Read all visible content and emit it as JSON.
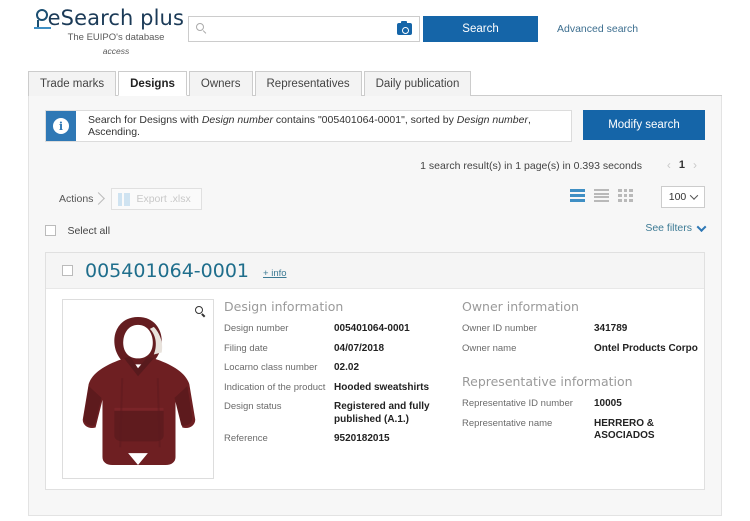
{
  "header": {
    "logo_text": "eSearch plus",
    "tagline": "The EUIPO's database",
    "tagline2": "access",
    "search_value": "",
    "search_placeholder": "",
    "camera_icon": "camera-icon",
    "search_button": "Search",
    "advanced_search": "Advanced search"
  },
  "tabs": [
    {
      "label": "Trade marks",
      "active": false
    },
    {
      "label": "Designs",
      "active": true
    },
    {
      "label": "Owners",
      "active": false
    },
    {
      "label": "Representatives",
      "active": false
    },
    {
      "label": "Daily publication",
      "active": false
    }
  ],
  "info_banner": {
    "icon": "info-icon",
    "prefix": "Search for Designs with ",
    "field1": "Design number",
    "middle": " contains \"005401064-0001\", sorted by ",
    "field2": "Design number",
    "suffix": ", Ascending.",
    "modify_button": "Modify search"
  },
  "results": {
    "meta": "1 search result(s) in 1 page(s) in 0.393 seconds",
    "prev_arrow": "‹",
    "page_number": "1",
    "next_arrow": "›"
  },
  "toolbar": {
    "actions_label": "Actions",
    "export_label": "Export .xlsx",
    "export_icon": "xlsx-icon",
    "view_list_icon": "list-view-icon",
    "view_compact_icon": "compact-list-view-icon",
    "view_grid_icon": "grid-view-icon",
    "page_size": "100",
    "select_all_label": "Select all",
    "see_filters_label": "See filters"
  },
  "card": {
    "design_number_title": "005401064-0001",
    "plus_info": "+ info",
    "thumbnail_alt": "hooded-sweatshirt-maroon",
    "zoom_icon": "magnifier-zoom-icon",
    "design_information": {
      "title": "Design information",
      "rows": [
        {
          "label": "Design number",
          "value": "005401064-0001"
        },
        {
          "label": "Filing date",
          "value": "04/07/2018"
        },
        {
          "label": "Locarno class number",
          "value": "02.02"
        },
        {
          "label": "Indication of the product",
          "value": "Hooded sweatshirts"
        },
        {
          "label": "Design status",
          "value": "Registered and fully published (A.1.)"
        },
        {
          "label": "Reference",
          "value": "9520182015"
        }
      ]
    },
    "owner_information": {
      "title": "Owner information",
      "rows": [
        {
          "label": "Owner ID number",
          "value": "341789"
        },
        {
          "label": "Owner name",
          "value": "Ontel Products Corpo"
        }
      ]
    },
    "representative_information": {
      "title": "Representative information",
      "rows": [
        {
          "label": "Representative ID number",
          "value": "10005"
        },
        {
          "label": "Representative name",
          "value": "HERRERO & ASOCIADOS"
        }
      ]
    }
  },
  "colors": {
    "brand_blue": "#1565a8",
    "link_teal": "#3c7a94",
    "title_teal": "#1f6e8c",
    "panel_bg": "#f7f7f7",
    "garment_maroon": "#6e1f22"
  }
}
